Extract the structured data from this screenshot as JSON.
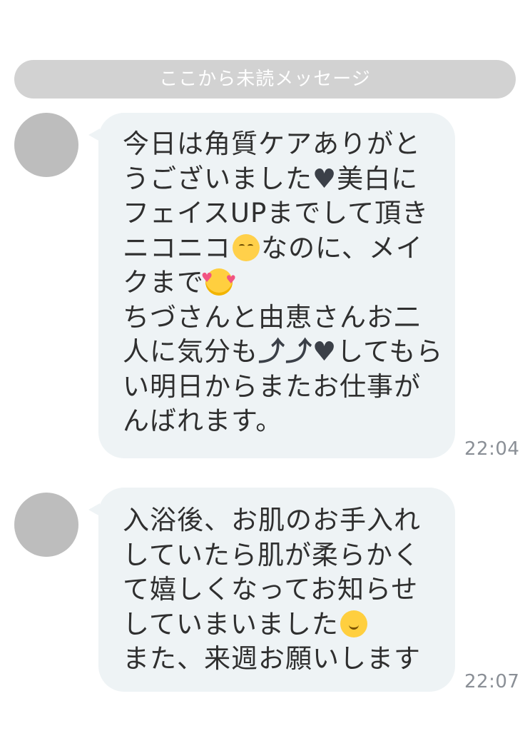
{
  "unread_banner": {
    "label": "ここから未読メッセージ"
  },
  "messages": [
    {
      "avatar_icon": "avatar-placeholder",
      "lines": [
        {
          "text": "今日は角質ケアありがと"
        },
        {
          "parts": [
            "うございました",
            "♥",
            "美白に"
          ]
        },
        {
          "text": "フェイスUPまでして頂き"
        },
        {
          "parts": [
            "ニコニコ",
            "smiling-face-emoji",
            "なのに、メイ"
          ]
        },
        {
          "parts": [
            "クまで",
            "smiling-face-with-hearts-emoji"
          ]
        },
        {
          "text": "ちづさんと由恵さんお二"
        },
        {
          "parts": [
            "人に気分も",
            "⤴⤴",
            "♥",
            "してもら"
          ]
        },
        {
          "text": "い明日からまたお仕事が"
        },
        {
          "text": "んばれます。"
        }
      ],
      "time": "22:04"
    },
    {
      "avatar_icon": "avatar-placeholder",
      "lines": [
        {
          "text": "入浴後、お肌のお手入れ"
        },
        {
          "text": "していたら肌が柔らかく"
        },
        {
          "text": "て嬉しくなってお知らせ"
        },
        {
          "parts": [
            "していまいました",
            "happy-sparkle-emoji"
          ]
        },
        {
          "text": "また、来週お願いします"
        }
      ],
      "time": "22:07"
    }
  ],
  "colors": {
    "banner_bg": "#d2d2d2",
    "bubble_bg": "#eef3f5",
    "text": "#2f2f2f",
    "time": "#8a8f96"
  }
}
